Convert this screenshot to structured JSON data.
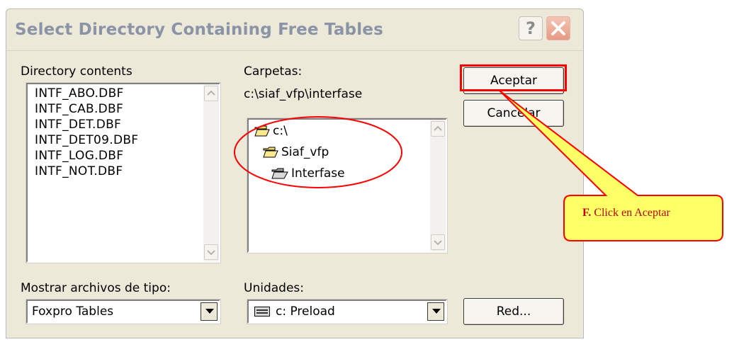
{
  "dialog": {
    "title": "Select Directory Containing Free Tables",
    "help_glyph": "?",
    "left_section": {
      "label": "Directory contents",
      "files": [
        "INTF_ABO.DBF",
        "INTF_CAB.DBF",
        "INTF_DET.DBF",
        "INTF_DET09.DBF",
        "INTF_LOG.DBF",
        "INTF_NOT.DBF"
      ],
      "filetype_label": "Mostrar archivos de tipo:",
      "filetype_value": "Foxpro Tables"
    },
    "middle_section": {
      "label": "Carpetas:",
      "path": "c:\\siaf_vfp\\interfase",
      "folders": [
        "c:\\",
        "Siaf_vfp",
        "Interfase"
      ],
      "drives_label": "Unidades:",
      "drive_value": "c: Preload"
    },
    "buttons": {
      "ok": "Aceptar",
      "cancel": "Cancelar",
      "network": "Red..."
    }
  },
  "annotation": {
    "callout_prefix": "F.",
    "callout_text": " Click en Aceptar",
    "highlight_color": "#ff0000",
    "callout_fill": "#ffff66"
  }
}
